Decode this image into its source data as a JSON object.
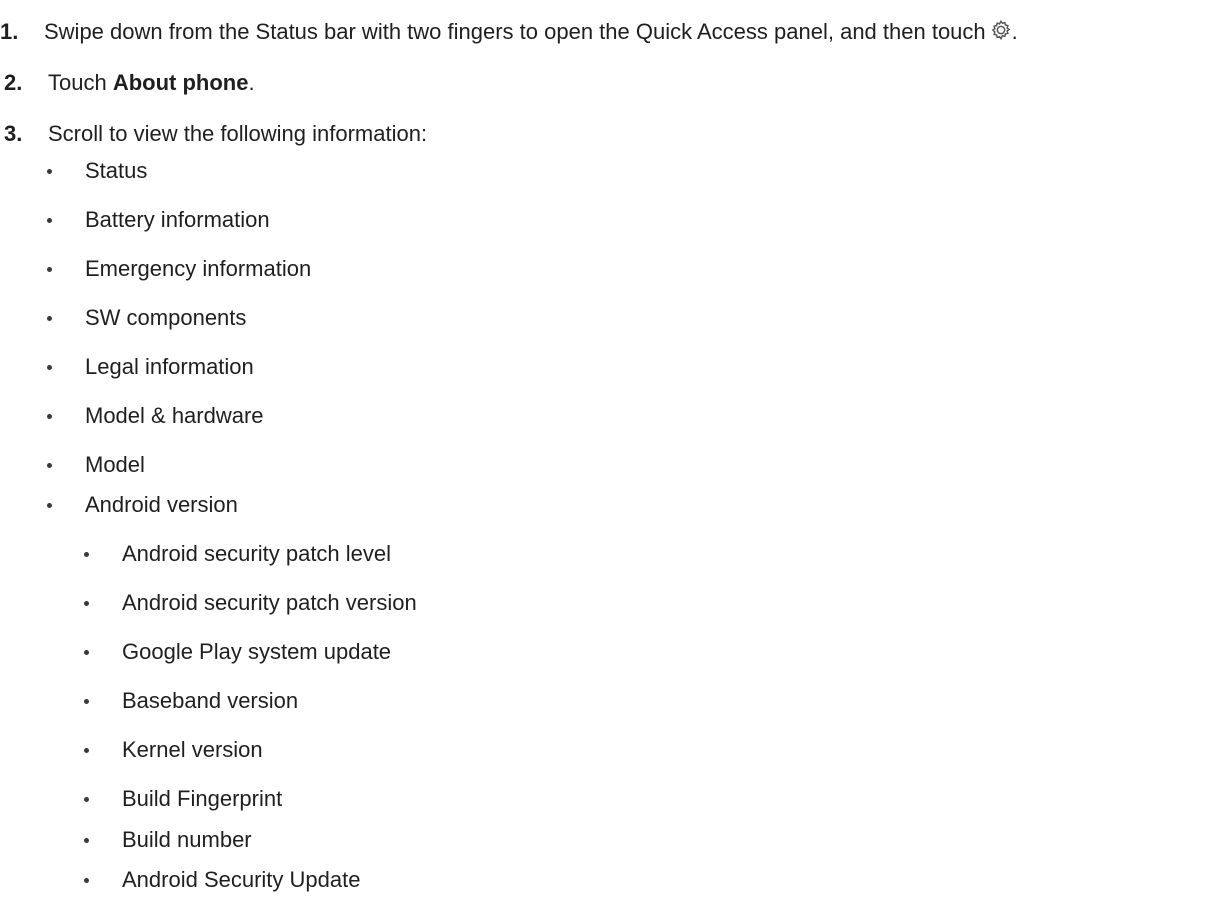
{
  "steps": [
    {
      "number": "1.",
      "text_before": "Swipe down from the Status bar with two fingers to open the Quick Access panel, and then touch",
      "icon": "gear-icon",
      "text_after": "."
    },
    {
      "number": "2.",
      "text_before": "Touch ",
      "bold": "About phone",
      "text_after": "."
    },
    {
      "number": "3.",
      "text": "Scroll to view the following information:"
    }
  ],
  "info_items": [
    "Status",
    "Battery information",
    "Emergency information",
    "SW components",
    "Legal information",
    "Model & hardware",
    "Model",
    "Android version"
  ],
  "android_version_subitems": [
    "Android security patch level",
    "Android security patch version",
    "Google Play system update",
    "Baseband version",
    "Kernel version",
    "Build Fingerprint",
    "Build number",
    "Android Security Update"
  ]
}
